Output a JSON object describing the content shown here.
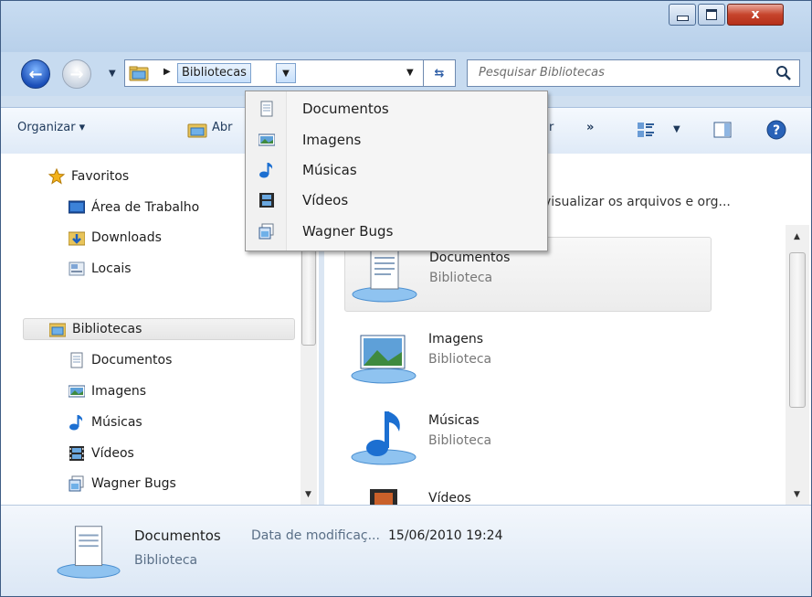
{
  "window": {
    "close_glyph": "x"
  },
  "nav": {
    "address_crumb": "Bibliotecas",
    "search_placeholder": "Pesquisar Bibliotecas"
  },
  "toolbar": {
    "organize": "Organizar ▾",
    "open_partial": "Abr",
    "partial_r": "r",
    "more": "»"
  },
  "dropdown": {
    "items": [
      {
        "label": "Documentos",
        "icon": "document-icon"
      },
      {
        "label": "Imagens",
        "icon": "pictures-icon"
      },
      {
        "label": "Músicas",
        "icon": "music-note-icon"
      },
      {
        "label": "Vídeos",
        "icon": "video-film-icon"
      },
      {
        "label": "Wagner Bugs",
        "icon": "user-library-icon"
      }
    ]
  },
  "sidebar": {
    "favorites_header": "Favoritos",
    "favorites": [
      {
        "label": "Área de Trabalho",
        "icon": "desktop-icon"
      },
      {
        "label": "Downloads",
        "icon": "downloads-folder-icon"
      },
      {
        "label": "Locais",
        "icon": "recent-places-icon"
      }
    ],
    "libraries_header": "Bibliotecas",
    "libraries": [
      {
        "label": "Documentos",
        "icon": "document-icon"
      },
      {
        "label": "Imagens",
        "icon": "pictures-icon"
      },
      {
        "label": "Músicas",
        "icon": "music-note-icon"
      },
      {
        "label": "Vídeos",
        "icon": "video-film-icon"
      },
      {
        "label": "Wagner Bugs",
        "icon": "user-library-icon"
      }
    ]
  },
  "content": {
    "header_fragment": "visualizar os arquivos e org...",
    "items": [
      {
        "name": "Documentos",
        "kind": "Biblioteca"
      },
      {
        "name": "Imagens",
        "kind": "Biblioteca"
      },
      {
        "name": "Músicas",
        "kind": "Biblioteca"
      },
      {
        "name": "Vídeos",
        "kind": ""
      }
    ]
  },
  "details": {
    "name": "Documentos",
    "meta_label": "Data de modificaç...",
    "meta_value": "15/06/2010 19:24",
    "kind": "Biblioteca"
  },
  "colors": {
    "frame": "#cfdff0",
    "accent": "#2e5ea6"
  }
}
